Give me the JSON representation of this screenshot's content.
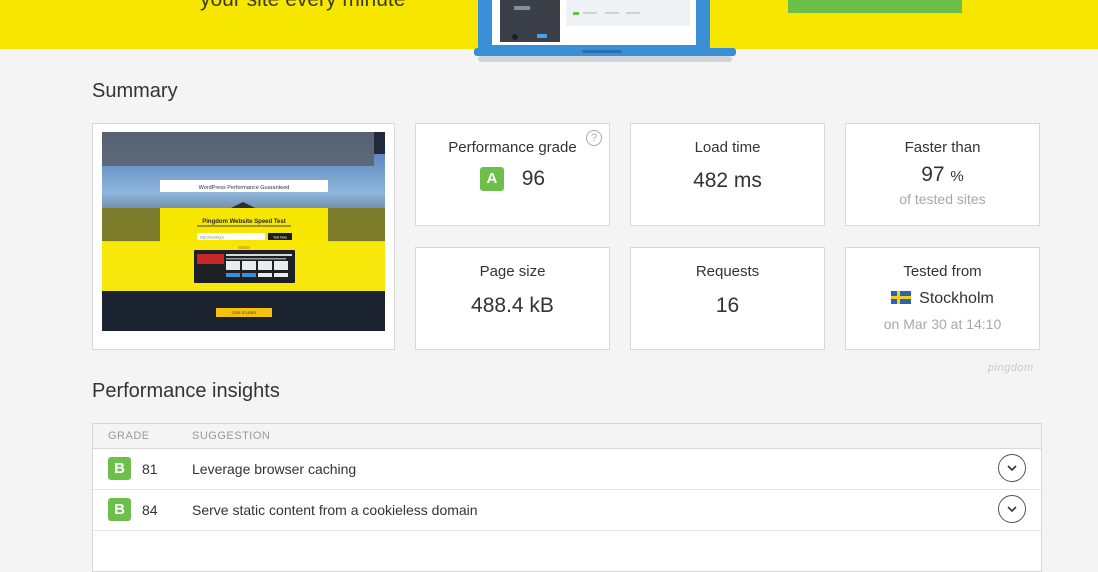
{
  "hero": {
    "tagline": "your site every minute"
  },
  "summary": {
    "title": "Summary",
    "screenshot": {
      "banner": "WordPress Performance Guaranteed",
      "heading": "Pingdom Website Speed Test",
      "input_value": "http://hosting.io",
      "button": "Test Now",
      "footer_button": "CASE STUDIES"
    },
    "performance_grade": {
      "label": "Performance grade",
      "grade": "A",
      "value": "96",
      "help": "?"
    },
    "load_time": {
      "label": "Load time",
      "value": "482 ms"
    },
    "faster_than": {
      "label": "Faster than",
      "value": "97",
      "unit": "%",
      "sub": "of tested sites"
    },
    "page_size": {
      "label": "Page size",
      "value": "488.4 kB"
    },
    "requests": {
      "label": "Requests",
      "value": "16"
    },
    "tested_from": {
      "label": "Tested from",
      "location": "Stockholm",
      "date": "on Mar 30 at 14:10"
    },
    "brand_mark": "pingdom"
  },
  "insights": {
    "title": "Performance insights",
    "columns": {
      "grade": "GRADE",
      "suggestion": "SUGGESTION"
    },
    "rows": [
      {
        "grade": "B",
        "score": "81",
        "suggestion": "Leverage browser caching"
      },
      {
        "grade": "B",
        "score": "84",
        "suggestion": "Serve static content from a cookieless domain"
      }
    ]
  },
  "colors": {
    "hero_yellow": "#f7e600",
    "grade_a": "#6cc04a",
    "grade_b": "#6cc04a"
  }
}
